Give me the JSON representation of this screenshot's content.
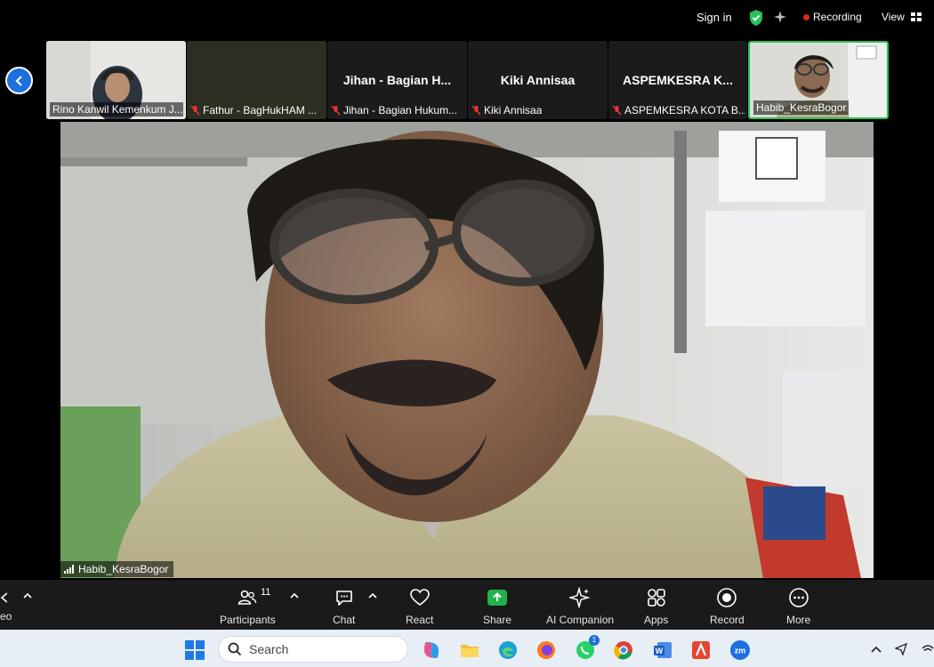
{
  "topbar": {
    "signin_label": "Sign in",
    "recording_label": "Recording",
    "view_label": "View"
  },
  "thumbnails": [
    {
      "big_name": "",
      "label": "Rino Kanwil Kemenkum J...",
      "muted": false
    },
    {
      "big_name": "",
      "label": "Fathur - BagHukHAM ...",
      "muted": true
    },
    {
      "big_name": "Jihan - Bagian H...",
      "label": "Jihan - Bagian Hukum...",
      "muted": true
    },
    {
      "big_name": "Kiki Annisaa",
      "label": "Kiki Annisaa",
      "muted": true
    },
    {
      "big_name": "ASPEMKESRA K...",
      "label": "ASPEMKESRA KOTA B...",
      "muted": true
    },
    {
      "big_name": "",
      "label": "Habib_KesraBogor",
      "muted": false
    }
  ],
  "main_speaker": {
    "label": "Habib_KesraBogor"
  },
  "toolbar": {
    "left_edge_label": "eo",
    "participants_label": "Participants",
    "participants_count": "11",
    "chat_label": "Chat",
    "react_label": "React",
    "share_label": "Share",
    "ai_companion_label": "AI Companion",
    "apps_label": "Apps",
    "record_label": "Record",
    "more_label": "More"
  },
  "taskbar": {
    "search_placeholder": "Search",
    "whatsapp_badge": "1"
  },
  "colors": {
    "zoom_blue": "#1e6fe0",
    "active_green": "#27c05a",
    "record_red": "#e02828",
    "share_green": "#22b14c"
  }
}
